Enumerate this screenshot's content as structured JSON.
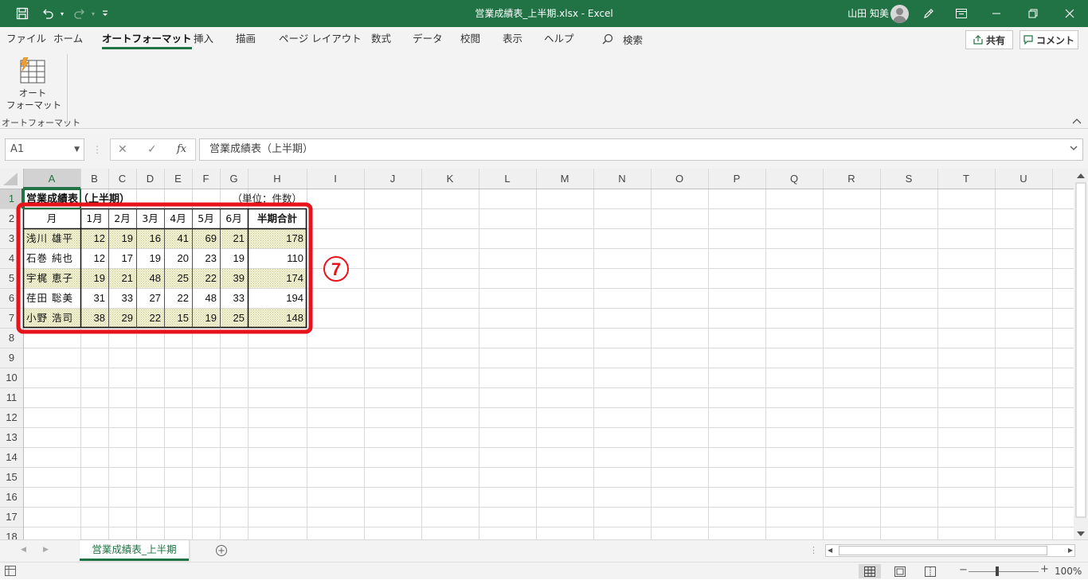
{
  "window": {
    "title": "営業成績表_上半期.xlsx  -  Excel",
    "user": "山田 知美",
    "accent": "#217346"
  },
  "quick_access": {
    "save_icon": "save-icon",
    "undo_icon": "undo-icon",
    "redo_icon": "redo-icon",
    "customize_icon": "customize-qat-icon"
  },
  "menu": {
    "tabs": [
      "ファイル",
      "ホーム",
      "オートフォーマット",
      "挿入",
      "描画",
      "ページ レイアウト",
      "数式",
      "データ",
      "校閲",
      "表示",
      "ヘルプ"
    ],
    "active_tab": "オートフォーマット",
    "search": "検索",
    "share": "共有",
    "comment": "コメント"
  },
  "ribbon": {
    "autoformat_label": "オート\nフォーマット",
    "group_label": "オートフォーマット"
  },
  "formula_bar": {
    "name_box": "A1",
    "cancel": "✕",
    "enter": "✓",
    "fx": "fx",
    "content": "営業成績表（上半期）"
  },
  "sheet": {
    "columns": [
      "A",
      "B",
      "C",
      "D",
      "E",
      "F",
      "G",
      "H",
      "I",
      "J",
      "K",
      "L",
      "M",
      "N",
      "O",
      "P",
      "Q",
      "R",
      "S",
      "T",
      "U"
    ],
    "rows": [
      "1",
      "2",
      "3",
      "4",
      "5",
      "6",
      "7",
      "8",
      "9",
      "10",
      "11",
      "12",
      "13",
      "14",
      "15",
      "16",
      "17",
      "18"
    ],
    "title": "営業成績表（上半期）",
    "unit": "（単位：件数）",
    "header": [
      "月",
      "1月",
      "2月",
      "3月",
      "4月",
      "5月",
      "6月",
      "半期合計"
    ],
    "data": [
      [
        "浅川 雄平",
        "12",
        "19",
        "16",
        "41",
        "69",
        "21",
        "178"
      ],
      [
        "石巻 純也",
        "12",
        "17",
        "19",
        "20",
        "23",
        "19",
        "110"
      ],
      [
        "宇梶 恵子",
        "19",
        "21",
        "48",
        "25",
        "22",
        "39",
        "174"
      ],
      [
        "荏田 聡美",
        "31",
        "33",
        "27",
        "22",
        "48",
        "33",
        "194"
      ],
      [
        "小野 浩司",
        "38",
        "29",
        "22",
        "15",
        "19",
        "25",
        "148"
      ]
    ],
    "annotation": "7",
    "highlight_color": "#e8141b",
    "stripe_color": "#efefc8"
  },
  "sheet_tabs": [
    "営業成績表_上半期"
  ],
  "status": {
    "zoom": "100%"
  }
}
